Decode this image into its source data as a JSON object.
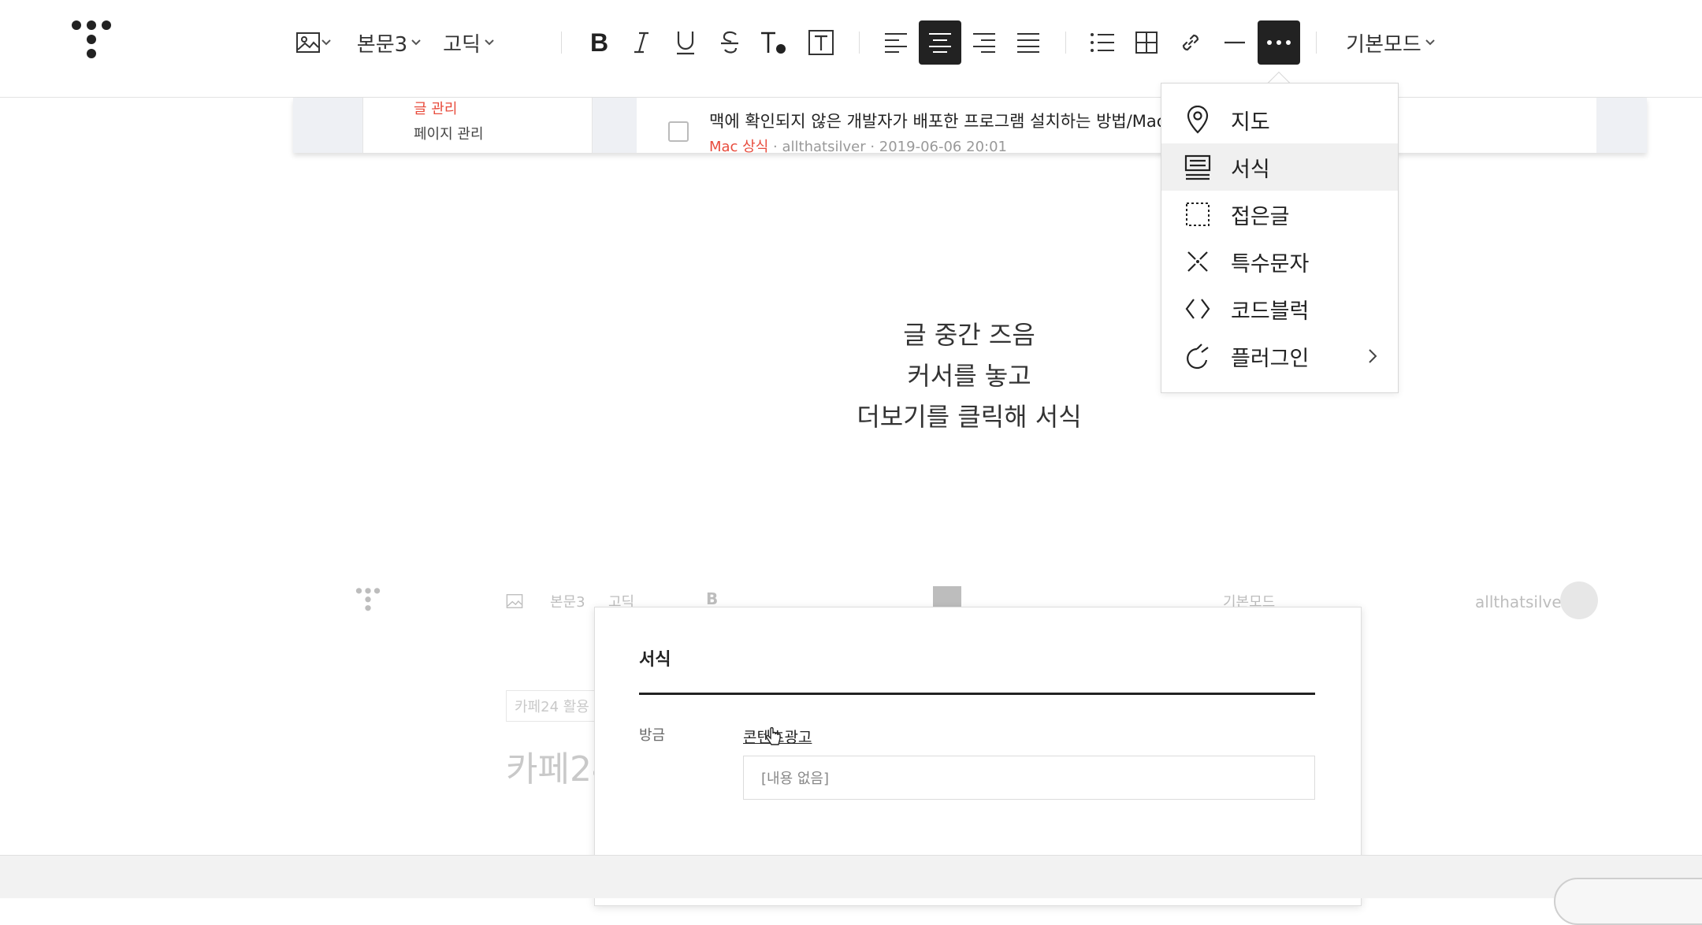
{
  "toolbar": {
    "text_style": "본문3",
    "font": "고딕",
    "mode": "기본모드"
  },
  "strip": {
    "sidebar_active": "글 관리",
    "sidebar_item": "페이지 관리",
    "post_title": "맥에 확인되지 않은 개발자가 배포한 프로그램 설치하는 방법/Mac",
    "post_category": "Mac 상식",
    "post_author": "allthatsilver",
    "post_date": "2019-06-06 20:01"
  },
  "content": {
    "line1": "글 중간 즈음",
    "line2": "커서를 놓고",
    "line3": "더보기를 클릭해 서식"
  },
  "more_menu": {
    "items": [
      {
        "label": "지도",
        "icon": "map-pin-icon"
      },
      {
        "label": "서식",
        "icon": "template-icon"
      },
      {
        "label": "접은글",
        "icon": "folded-text-icon"
      },
      {
        "label": "특수문자",
        "icon": "special-char-icon"
      },
      {
        "label": "코드블럭",
        "icon": "code-block-icon"
      },
      {
        "label": "플러그인",
        "icon": "plugin-icon"
      }
    ]
  },
  "editor2": {
    "text_style": "본문3",
    "font": "고딕",
    "mode": "기본모드",
    "username": "allthatsilver",
    "category": "카페24 활용",
    "title_partial": "카페24"
  },
  "dialog": {
    "title": "서식",
    "row_label": "방금",
    "link": "콘텐츠광고",
    "empty": "[내용 없음]"
  },
  "colors": {
    "accent_red": "#e84c3d",
    "dark": "#222222"
  }
}
